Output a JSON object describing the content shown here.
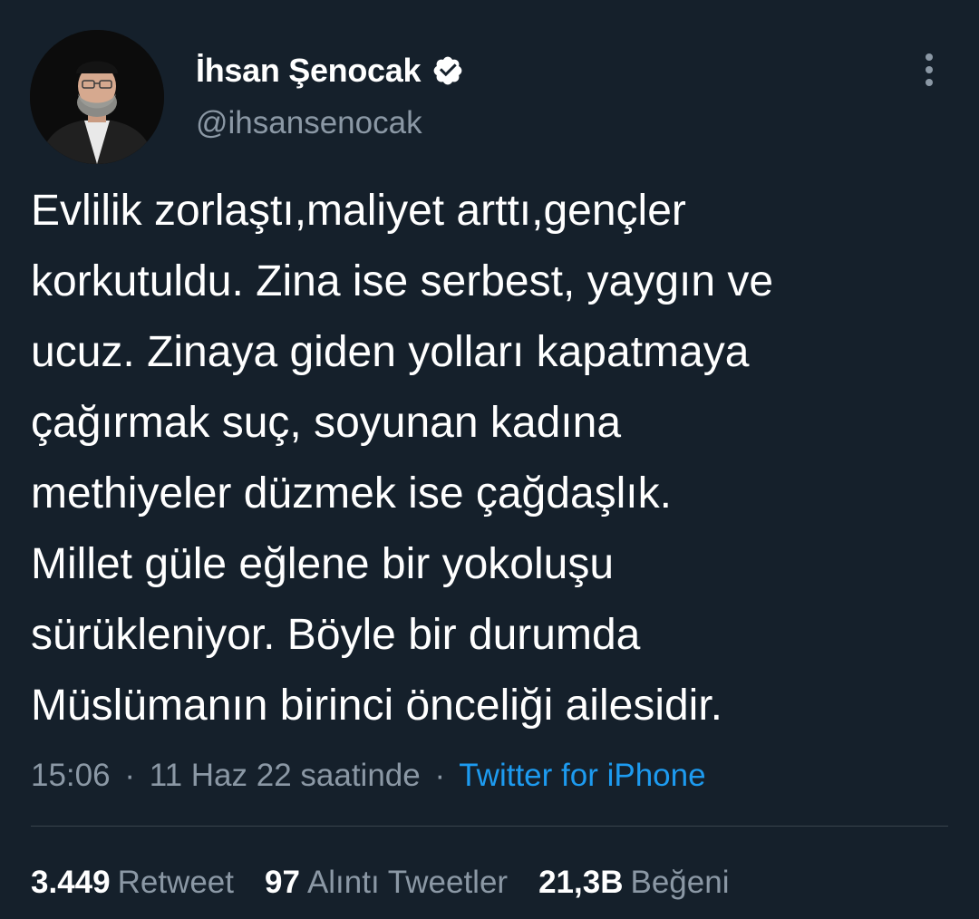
{
  "author": {
    "display_name": "İhsan Şenocak",
    "handle": "@ihsansenocak",
    "verified": true,
    "avatar_icon": "profile-photo"
  },
  "menu": {
    "icon": "more-vertical-icon"
  },
  "tweet": {
    "lines": [
      "Evlilik zorlaştı,maliyet arttı,gençler",
      "korkutuldu. Zina ise serbest, yaygın ve",
      "ucuz. Zinaya giden yolları kapatmaya",
      "çağırmak suç, soyunan kadına",
      "methiyeler düzmek ise çağdaşlık.",
      "Millet güle eğlene bir yokoluşu",
      "sürükleniyor. Böyle bir durumda",
      "Müslümanın birinci önceliği ailesidir."
    ]
  },
  "meta": {
    "time": "15:06",
    "separator": "·",
    "date": "11 Haz 22 saatinde",
    "source": "Twitter for iPhone"
  },
  "stats": {
    "retweets": {
      "count": "3.449",
      "label": "Retweet"
    },
    "quotes": {
      "count": "97",
      "label": "Alıntı Tweetler"
    },
    "likes": {
      "count": "21,3B",
      "label": "Beğeni"
    }
  },
  "colors": {
    "background": "#15202b",
    "text": "#ffffff",
    "secondary": "#8b98a5",
    "link": "#1d9bf0",
    "divider": "#38444d"
  }
}
